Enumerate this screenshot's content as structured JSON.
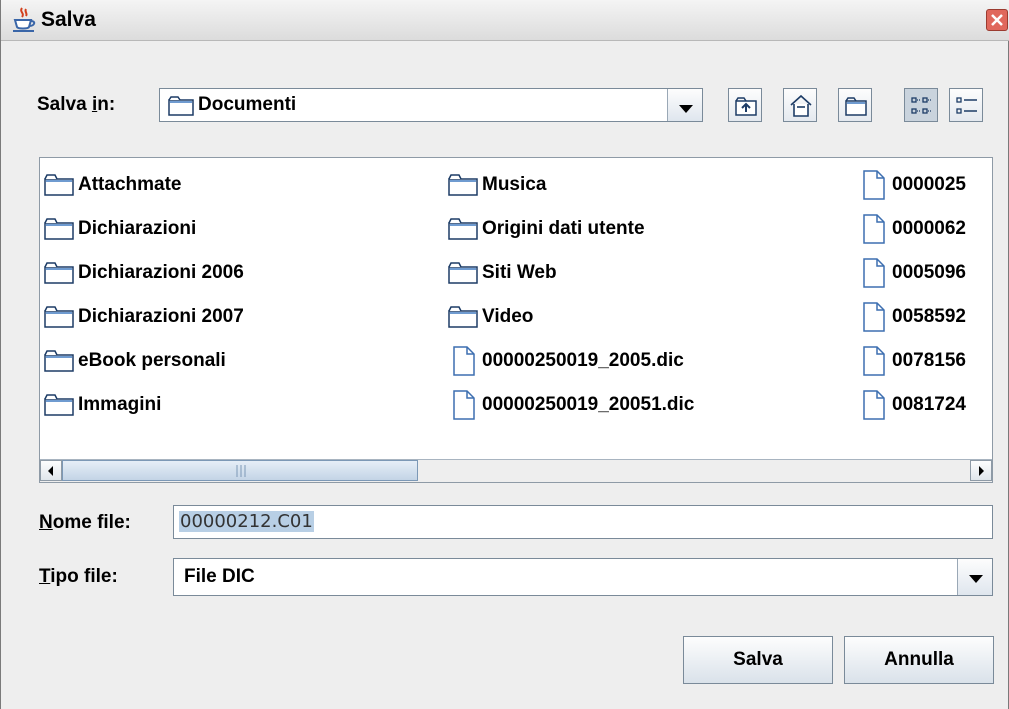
{
  "window": {
    "title": "Salva"
  },
  "save_in": {
    "label_before": "Salva ",
    "label_mnemonic": "i",
    "label_after": "n:",
    "value": "Documenti"
  },
  "toolbar": {
    "buttons": [
      {
        "icon": "up-folder-icon"
      },
      {
        "icon": "home-icon"
      },
      {
        "icon": "new-folder-icon"
      },
      {
        "icon": "list-view-icon"
      },
      {
        "icon": "details-view-icon"
      }
    ]
  },
  "file_list": {
    "columns": [
      [
        {
          "name": "Attachmate",
          "type": "folder"
        },
        {
          "name": "Dichiarazioni",
          "type": "folder"
        },
        {
          "name": "Dichiarazioni 2006",
          "type": "folder"
        },
        {
          "name": "Dichiarazioni 2007",
          "type": "folder"
        },
        {
          "name": "eBook personali",
          "type": "folder"
        },
        {
          "name": "Immagini",
          "type": "folder"
        }
      ],
      [
        {
          "name": "Musica",
          "type": "folder"
        },
        {
          "name": "Origini dati utente",
          "type": "folder"
        },
        {
          "name": "Siti Web",
          "type": "folder"
        },
        {
          "name": "Video",
          "type": "folder"
        },
        {
          "name": "00000250019_2005.dic",
          "type": "file"
        },
        {
          "name": "00000250019_20051.dic",
          "type": "file"
        }
      ],
      [
        {
          "name": "0000025",
          "type": "file"
        },
        {
          "name": "0000062",
          "type": "file"
        },
        {
          "name": "0005096",
          "type": "file"
        },
        {
          "name": "0058592",
          "type": "file"
        },
        {
          "name": "0078156",
          "type": "file"
        },
        {
          "name": "0081724",
          "type": "file"
        }
      ]
    ]
  },
  "file_name": {
    "label_mnemonic": "N",
    "label_rest": "ome file:",
    "value": "00000212.C01"
  },
  "file_type": {
    "label_mnemonic": "T",
    "label_rest": "ipo file:",
    "value": "File DIC"
  },
  "actions": {
    "save_label": "Salva",
    "cancel_label": "Annulla"
  }
}
